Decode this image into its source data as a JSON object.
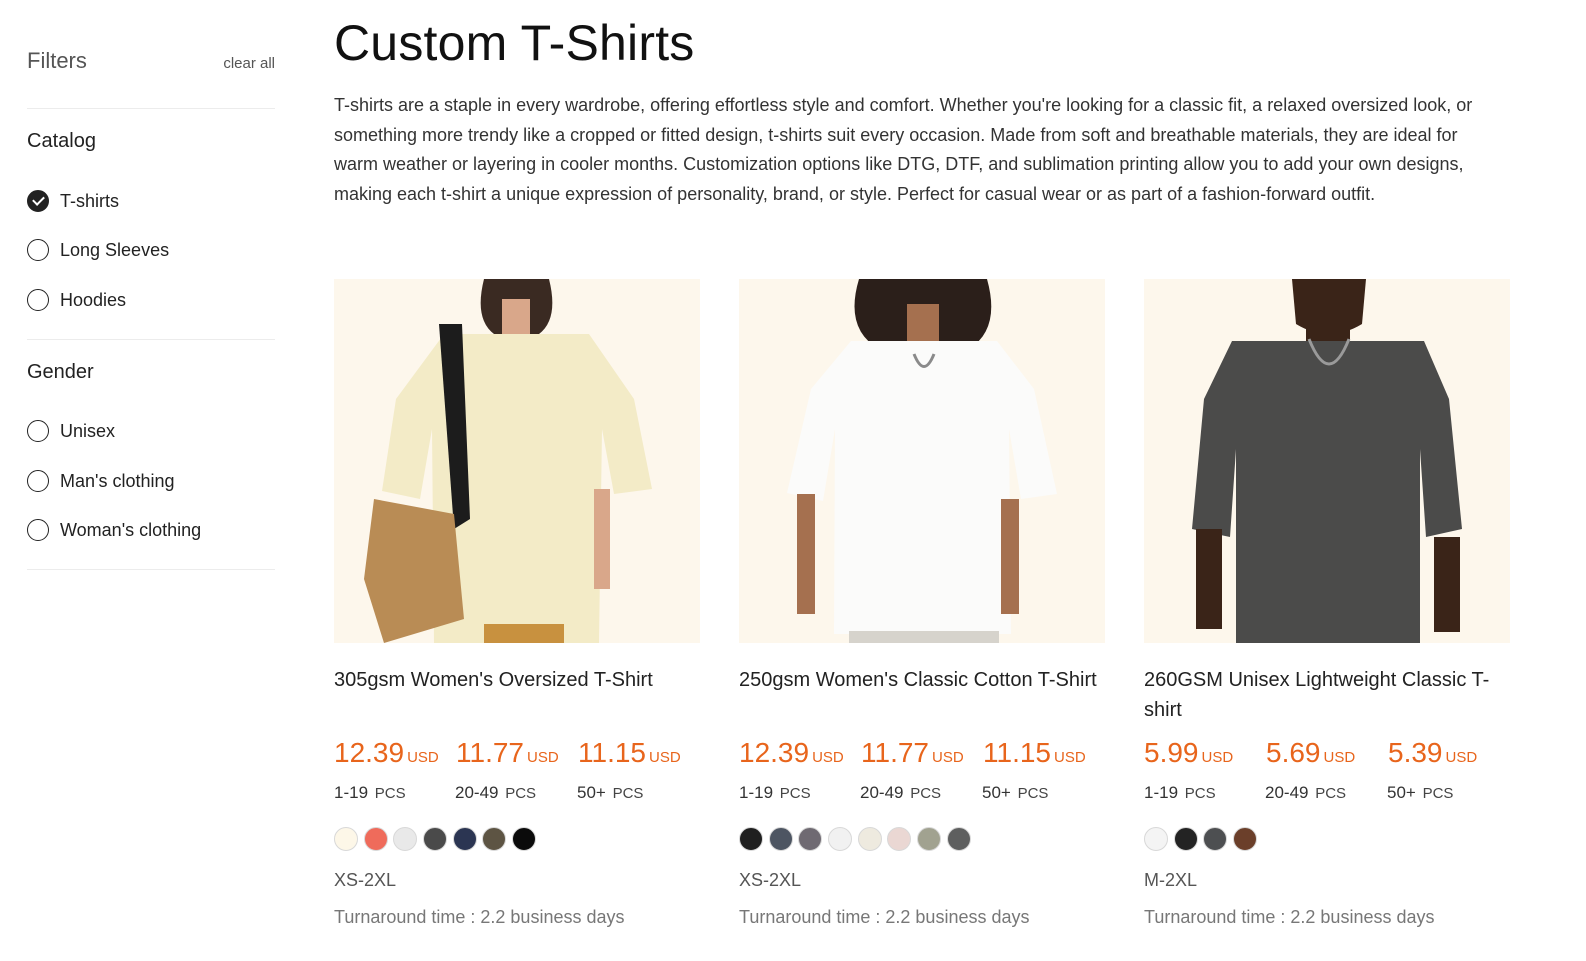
{
  "sidebar": {
    "title": "Filters",
    "clear_all": "clear all",
    "catalog": {
      "title": "Catalog",
      "options": [
        {
          "label": "T-shirts",
          "checked": true
        },
        {
          "label": "Long Sleeves",
          "checked": false
        },
        {
          "label": "Hoodies",
          "checked": false
        }
      ]
    },
    "gender": {
      "title": "Gender",
      "options": [
        {
          "label": "Unisex",
          "checked": false
        },
        {
          "label": "Man's clothing",
          "checked": false
        },
        {
          "label": "Woman's clothing",
          "checked": false
        }
      ]
    }
  },
  "main": {
    "title": "Custom T-Shirts",
    "description": "T-shirts are a staple in every wardrobe, offering effortless style and comfort. Whether you're looking for a classic fit, a relaxed oversized look, or something more trendy like a cropped or fitted design, t-shirts suit every occasion. Made from soft and breathable materials, they are ideal for warm weather or layering in cooler months. Customization options like DTG, DTF, and sublimation printing allow you to add your own designs, making each t-shirt a unique expression of personality, brand, or style. Perfect for casual wear or as part of a fashion-forward outfit."
  },
  "products": [
    {
      "name": "305gsm Women's Oversized T-Shirt",
      "image": "woman-cream-oversized-tshirt-with-bag",
      "shirt_color": "#f3ebc7",
      "prices": [
        {
          "amount": "12.39",
          "currency": "USD",
          "qty": "1-19",
          "unit": "PCS"
        },
        {
          "amount": "11.77",
          "currency": "USD",
          "qty": "20-49",
          "unit": "PCS"
        },
        {
          "amount": "11.15",
          "currency": "USD",
          "qty": "50+",
          "unit": "PCS"
        }
      ],
      "colors": [
        "#fdf7e8",
        "#ef6b5b",
        "#e9e9e9",
        "#4a4a4a",
        "#2b3552",
        "#5d5443",
        "#0b0b0b"
      ],
      "sizes": "XS-2XL",
      "turnaround": "Turnaround time : 2.2 business days"
    },
    {
      "name": "250gsm Women's Classic Cotton T-Shirt",
      "image": "woman-white-classic-tshirt",
      "shirt_color": "#fbfbfa",
      "prices": [
        {
          "amount": "12.39",
          "currency": "USD",
          "qty": "1-19",
          "unit": "PCS"
        },
        {
          "amount": "11.77",
          "currency": "USD",
          "qty": "20-49",
          "unit": "PCS"
        },
        {
          "amount": "11.15",
          "currency": "USD",
          "qty": "50+",
          "unit": "PCS"
        }
      ],
      "colors": [
        "#1f1f1f",
        "#4d5562",
        "#6f6a72",
        "#f1f1f1",
        "#eeeadf",
        "#ead7d3",
        "#a1a290",
        "#5e5f5f"
      ],
      "sizes": "XS-2XL",
      "turnaround": "Turnaround time : 2.2 business days"
    },
    {
      "name": "260GSM Unisex Lightweight Classic T-shirt",
      "image": "man-charcoal-classic-tshirt",
      "shirt_color": "#4b4b4a",
      "prices": [
        {
          "amount": "5.99",
          "currency": "USD",
          "qty": "1-19",
          "unit": "PCS"
        },
        {
          "amount": "5.69",
          "currency": "USD",
          "qty": "20-49",
          "unit": "PCS"
        },
        {
          "amount": "5.39",
          "currency": "USD",
          "qty": "50+",
          "unit": "PCS"
        }
      ],
      "colors": [
        "#f4f4f4",
        "#232323",
        "#4d4f51",
        "#6b3f2a"
      ],
      "sizes": "M-2XL",
      "turnaround": "Turnaround time : 2.2 business days"
    }
  ]
}
